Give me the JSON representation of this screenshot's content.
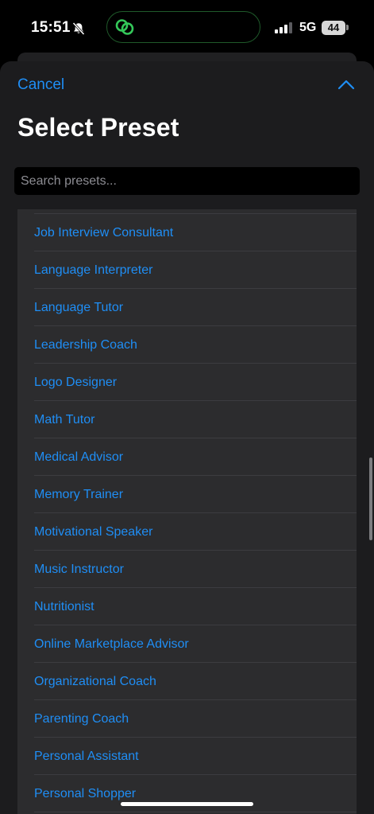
{
  "status_bar": {
    "time": "15:51",
    "network": "5G",
    "battery": "44",
    "icons": [
      "bell-slash-icon",
      "chat-link-icon",
      "signal-icon"
    ]
  },
  "colors": {
    "accent": "#1f8ef5",
    "sheet_bg": "#1c1c1e",
    "list_bg": "#2c2c2e",
    "island_border": "#1f5a2a",
    "island_icon": "#34c759"
  },
  "header": {
    "cancel_label": "Cancel",
    "collapse_icon": "chevron-up-icon",
    "title": "Select Preset"
  },
  "search": {
    "value": "",
    "placeholder": "Search presets..."
  },
  "presets": [
    "Job Interview Consultant",
    "Language Interpreter",
    "Language Tutor",
    "Leadership Coach",
    "Logo Designer",
    "Math Tutor",
    "Medical Advisor",
    "Memory Trainer",
    "Motivational Speaker",
    "Music Instructor",
    "Nutritionist",
    "Online Marketplace Advisor",
    "Organizational Coach",
    "Parenting Coach",
    "Personal Assistant",
    "Personal Shopper"
  ]
}
